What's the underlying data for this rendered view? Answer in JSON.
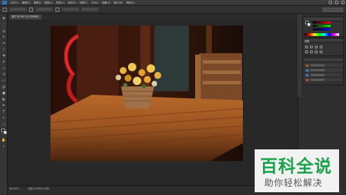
{
  "menubar": {
    "items": [
      "文件(F)",
      "编辑(E)",
      "图像(I)",
      "图层(L)",
      "类型(Y)",
      "选择(S)",
      "滤镜(T)",
      "3D(D)",
      "视图(V)",
      "窗口(W)",
      "帮助(H)"
    ]
  },
  "document": {
    "tab_label": "桌子 @ 66.7% (RGB/8)"
  },
  "status": {
    "zoom": "66.67%",
    "doc_info": "文档:2.63M/2.63M"
  },
  "panels": {
    "adjustments_label": "调整"
  },
  "watermark": {
    "title": "百科全说",
    "subtitle": "助你轻松解决"
  },
  "colors": {
    "watermark_green": "#1aa34a",
    "photoshop_blue": "#2b6fb5",
    "canvas_bg": "#282828"
  }
}
